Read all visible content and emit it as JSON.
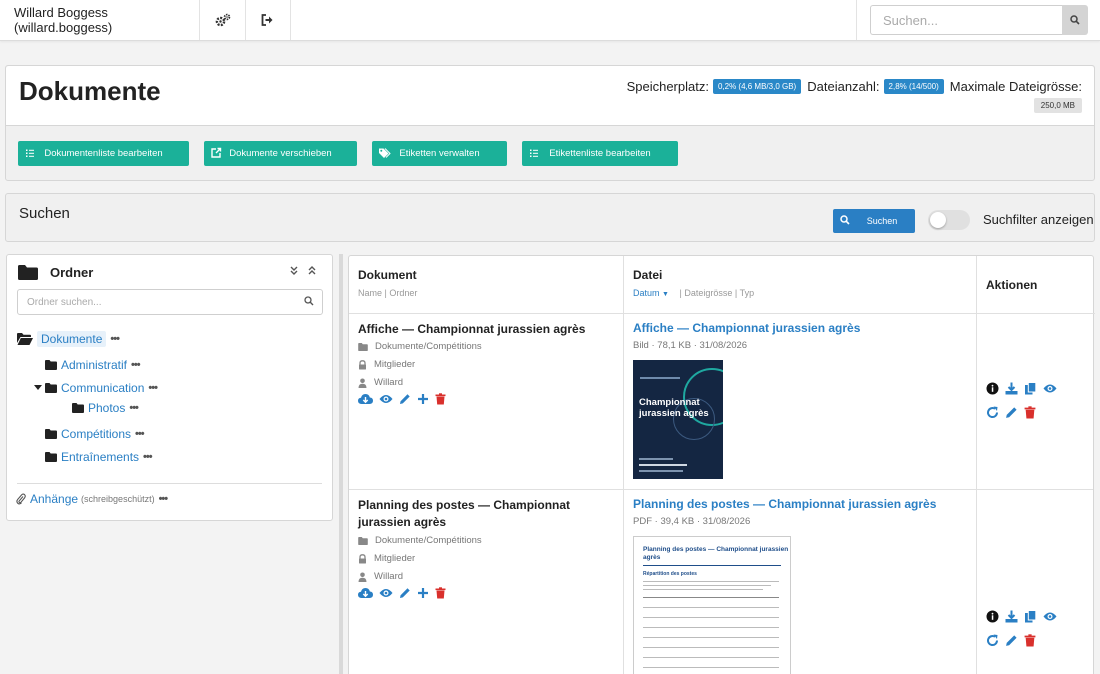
{
  "topbar": {
    "user": "Willard Boggess (willard.boggess)",
    "search_placeholder": "Suchen..."
  },
  "header": {
    "title": "Dokumente",
    "storage_label": "Speicherplatz:",
    "storage_value": "0,2% (4,6 MB/3,0 GB)",
    "filecount_label": "Dateianzahl:",
    "filecount_value": "2,8% (14/500)",
    "maxsize_label": "Maximale Dateigrösse:",
    "maxsize_value": "250,0 MB"
  },
  "actions": [
    {
      "label": "Dokumentenliste bearbeiten",
      "icon": "list-icon"
    },
    {
      "label": "Dokumente verschieben",
      "icon": "external-link-icon"
    },
    {
      "label": "Etiketten verwalten",
      "icon": "tags-icon"
    },
    {
      "label": "Etikettenliste bearbeiten",
      "icon": "list-icon"
    }
  ],
  "search_panel": {
    "title": "Suchen",
    "button": "Suchen",
    "toggle_label": "Suchfilter anzeigen",
    "toggle_on": false
  },
  "folders": {
    "title": "Ordner",
    "search_placeholder": "Ordner suchen...",
    "root": "Dokumente",
    "items": [
      {
        "label": "Administratif"
      },
      {
        "label": "Communication"
      },
      {
        "label": "Photos"
      },
      {
        "label": "Compétitions"
      },
      {
        "label": "Entraînements"
      }
    ],
    "attachments_label": "Anhänge",
    "attachments_note": "(schreibgeschützt)"
  },
  "table": {
    "col_document": "Dokument",
    "col_document_sub1": "Name",
    "col_document_sep": "|",
    "col_document_sub2": "Ordner",
    "col_file": "Datei",
    "col_file_sort": "Datum",
    "col_file_sep1": "|",
    "col_file_sub2": "Dateigrösse",
    "col_file_sep2": "|",
    "col_file_sub3": "Typ",
    "col_actions": "Aktionen",
    "rows": [
      {
        "title": "Affiche — Championnat jurassien agrès",
        "folder": "Dokumente/Compétitions",
        "group": "Mitglieder",
        "owner": "Willard",
        "file_title": "Affiche — Championnat jurassien agrès",
        "file_meta": "Bild · 78,1 KB · 31/08/2026",
        "poster_title": "Championnat jurassien agrès"
      },
      {
        "title": "Planning des postes — Championnat jurassien agrès",
        "folder": "Dokumente/Compétitions",
        "group": "Mitglieder",
        "owner": "Willard",
        "file_title": "Planning des postes — Championnat jurassien agrès",
        "file_meta": "PDF · 39,4 KB · 31/08/2026",
        "pdf_title": "Planning des postes — Championnat jurassien agrès",
        "pdf_sub": "Répartition des postes"
      }
    ]
  },
  "colors": {
    "accent_blue": "#2a7fc4",
    "green": "#1bb199",
    "danger": "#d9302c",
    "badge_blue": "#2a88c8"
  }
}
